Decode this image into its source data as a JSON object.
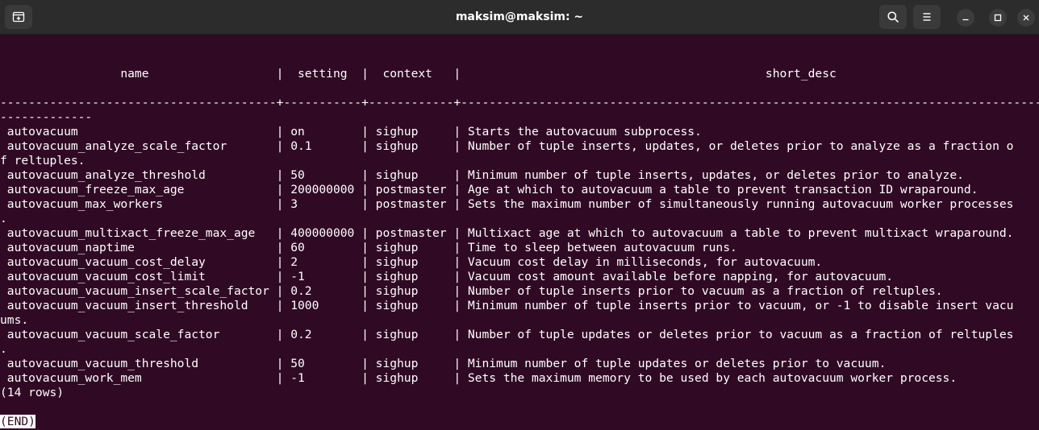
{
  "window": {
    "title": "maksim@maksim: ~"
  },
  "titlebar_icons": {
    "new_tab": "new-tab-icon",
    "search": "search-icon",
    "menu": "hamburger-menu-icon",
    "minimize": "minimize-icon",
    "maximize": "maximize-icon",
    "close": "close-icon"
  },
  "colors": {
    "terminal_background": "#300a24",
    "titlebar_background": "#2c2c2c",
    "text": "#ffffff"
  },
  "terminal": {
    "lines": [
      "",
      "",
      "                 name                  |  setting  |  context   |                                           short_desc",
      "",
      "---------------------------------------+-----------+------------+-----------------------------------------------------------------------------------------------------",
      "-------------",
      " autovacuum                            | on        | sighup     | Starts the autovacuum subprocess.",
      " autovacuum_analyze_scale_factor       | 0.1       | sighup     | Number of tuple inserts, updates, or deletes prior to analyze as a fraction o",
      "f reltuples.",
      " autovacuum_analyze_threshold          | 50        | sighup     | Minimum number of tuple inserts, updates, or deletes prior to analyze.",
      " autovacuum_freeze_max_age             | 200000000 | postmaster | Age at which to autovacuum a table to prevent transaction ID wraparound.",
      " autovacuum_max_workers                | 3         | postmaster | Sets the maximum number of simultaneously running autovacuum worker processes",
      ".",
      " autovacuum_multixact_freeze_max_age   | 400000000 | postmaster | Multixact age at which to autovacuum a table to prevent multixact wraparound.",
      " autovacuum_naptime                    | 60        | sighup     | Time to sleep between autovacuum runs.",
      " autovacuum_vacuum_cost_delay          | 2         | sighup     | Vacuum cost delay in milliseconds, for autovacuum.",
      " autovacuum_vacuum_cost_limit          | -1        | sighup     | Vacuum cost amount available before napping, for autovacuum.",
      " autovacuum_vacuum_insert_scale_factor | 0.2       | sighup     | Number of tuple inserts prior to vacuum as a fraction of reltuples.",
      " autovacuum_vacuum_insert_threshold    | 1000      | sighup     | Minimum number of tuple inserts prior to vacuum, or -1 to disable insert vacu",
      "ums.",
      " autovacuum_vacuum_scale_factor        | 0.2       | sighup     | Number of tuple updates or deletes prior to vacuum as a fraction of reltuples",
      ".",
      " autovacuum_vacuum_threshold           | 50        | sighup     | Minimum number of tuple updates or deletes prior to vacuum.",
      " autovacuum_work_mem                   | -1        | sighup     | Sets the maximum memory to be used by each autovacuum worker process.",
      "(14 rows)",
      ""
    ],
    "end_marker": "(END)"
  }
}
